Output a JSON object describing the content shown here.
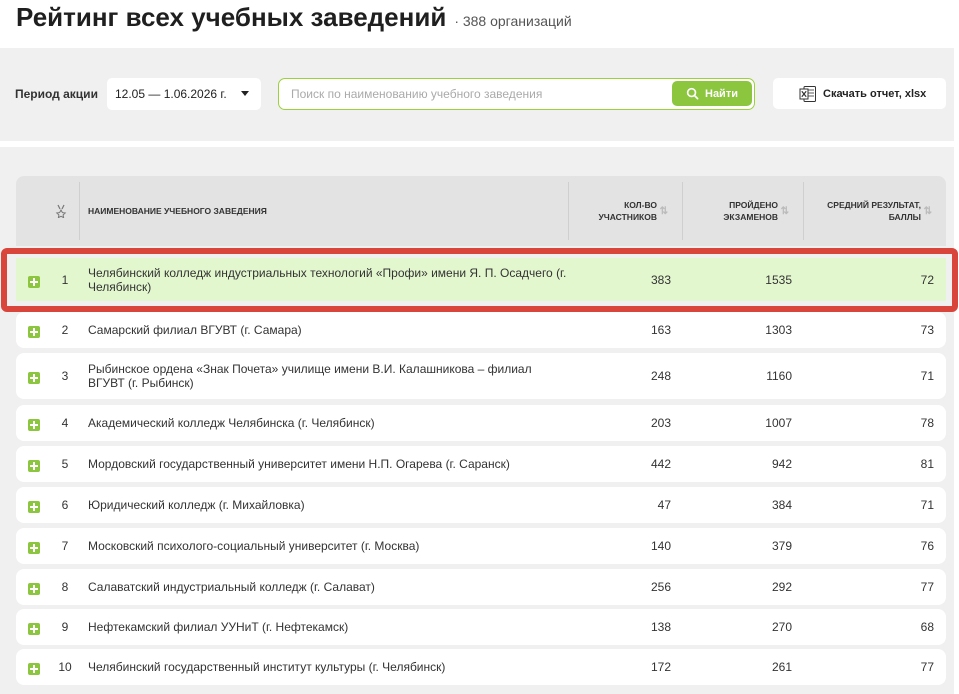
{
  "header": {
    "title": "Рейтинг всех учебных заведений",
    "count": "· 388 организаций"
  },
  "filters": {
    "period_label": "Период акции",
    "period_value": "12.05 — 1.06.2026 г.",
    "search_placeholder": "Поиск по наименованию учебного заведения",
    "search_button": "Найти",
    "download_button": "Скачать отчет, xlsx"
  },
  "table": {
    "columns": {
      "name": "Наименование учебного заведения",
      "participants": "Кол-во участников",
      "exams": "Пройдено экзаменов",
      "score": "Средний результат, баллы"
    },
    "rows": [
      {
        "rank": "1",
        "name": "Челябинский колледж индустриальных технологий «Профи» имени Я. П. Осадчего (г. Челябинск)",
        "participants": "383",
        "exams": "1535",
        "score": "72"
      },
      {
        "rank": "2",
        "name": "Самарский филиал ВГУВТ (г. Самара)",
        "participants": "163",
        "exams": "1303",
        "score": "73"
      },
      {
        "rank": "3",
        "name": "Рыбинское ордена «Знак Почета» училище имени В.И. Калашникова – филиал ВГУВТ (г. Рыбинск)",
        "participants": "248",
        "exams": "1160",
        "score": "71"
      },
      {
        "rank": "4",
        "name": "Академический колледж Челябинска (г. Челябинск)",
        "participants": "203",
        "exams": "1007",
        "score": "78"
      },
      {
        "rank": "5",
        "name": "Мордовский государственный университет имени Н.П. Огарева (г. Саранск)",
        "participants": "442",
        "exams": "942",
        "score": "81"
      },
      {
        "rank": "6",
        "name": "Юридический колледж (г. Михайловка)",
        "participants": "47",
        "exams": "384",
        "score": "71"
      },
      {
        "rank": "7",
        "name": "Московский психолого-социальный университет (г. Москва)",
        "participants": "140",
        "exams": "379",
        "score": "76"
      },
      {
        "rank": "8",
        "name": "Салаватский индустриальный колледж (г. Салават)",
        "participants": "256",
        "exams": "292",
        "score": "77"
      },
      {
        "rank": "9",
        "name": "Нефтекамский филиал УУНиТ (г. Нефтекамск)",
        "participants": "138",
        "exams": "270",
        "score": "68"
      },
      {
        "rank": "10",
        "name": "Челябинский государственный институт культуры (г. Челябинск)",
        "participants": "172",
        "exams": "261",
        "score": "77"
      }
    ]
  },
  "colors": {
    "accent": "#8cc63f",
    "highlight_row": "#e3f7cf",
    "focus_frame": "#d9443b"
  },
  "icons": {
    "rank_header": "medal-icon",
    "search": "search-icon",
    "download": "excel-icon",
    "expand": "plus-icon",
    "sort": "sort-icon"
  }
}
